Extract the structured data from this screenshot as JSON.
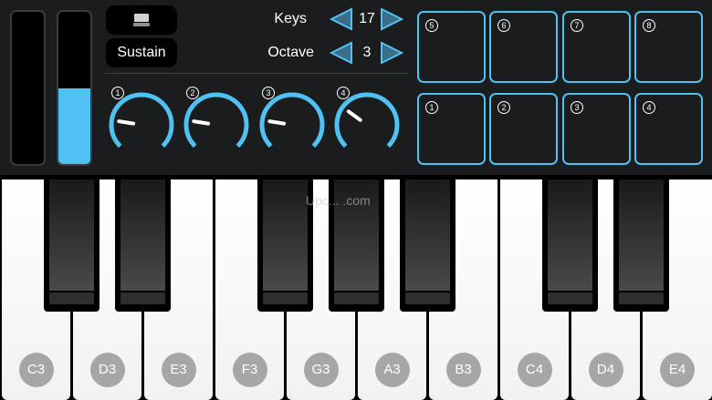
{
  "sliders": [
    {
      "name": "left",
      "level": 0
    },
    {
      "name": "right",
      "level": 0.5
    }
  ],
  "buttons": {
    "keyboard_icon": "keyboard-icon",
    "sustain_label": "Sustain"
  },
  "keys": {
    "label": "Keys",
    "value": "17"
  },
  "octave": {
    "label": "Octave",
    "value": "3"
  },
  "knobs": [
    {
      "number": "1",
      "value": 0.2
    },
    {
      "number": "2",
      "value": 0.2
    },
    {
      "number": "3",
      "value": 0.2
    },
    {
      "number": "4",
      "value": 0.3
    }
  ],
  "pads": {
    "top_row": [
      "5",
      "6",
      "7",
      "8"
    ],
    "bottom_row": [
      "1",
      "2",
      "3",
      "4"
    ]
  },
  "piano": {
    "white_keys": [
      "C3",
      "D3",
      "E3",
      "F3",
      "G3",
      "A3",
      "B3",
      "C4",
      "D4",
      "E4"
    ]
  },
  "watermark": "Upc... .com",
  "colors": {
    "accent": "#4fc1f2",
    "panel": "#1b1c1e"
  }
}
